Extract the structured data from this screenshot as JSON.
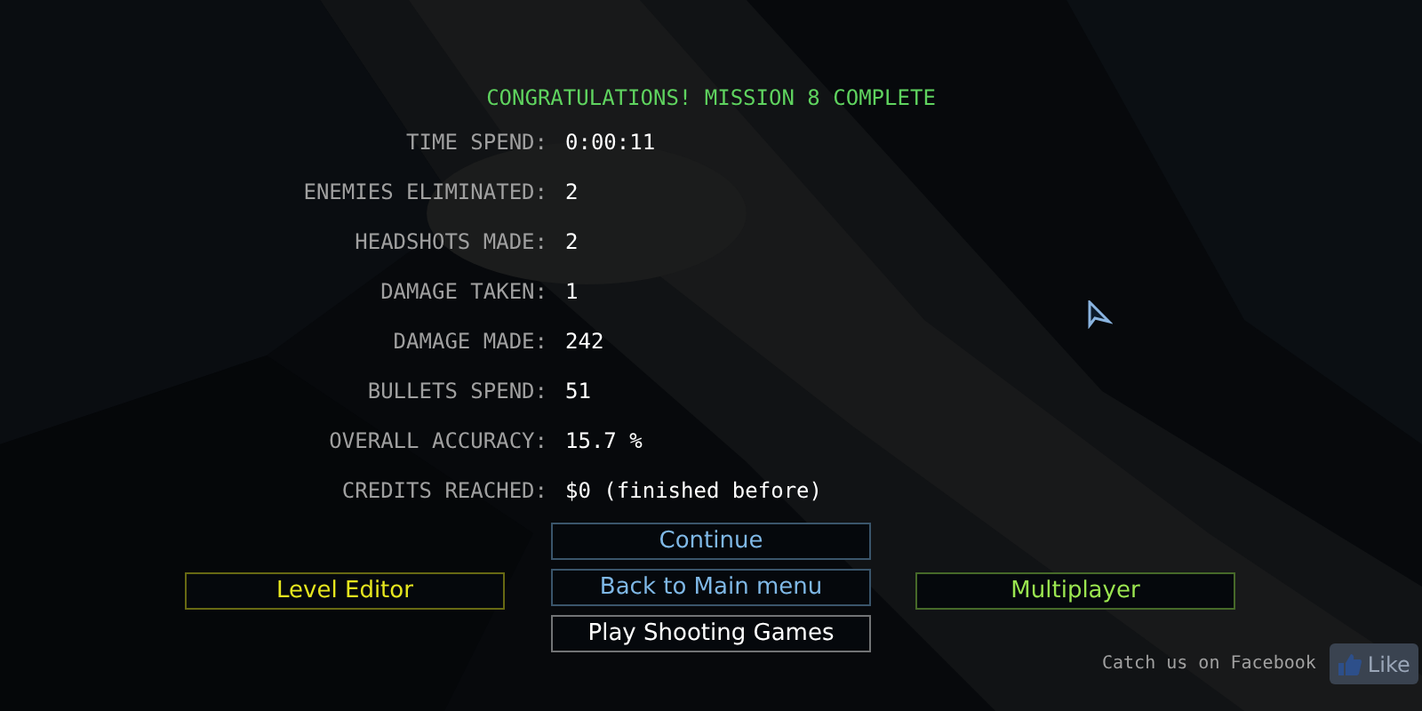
{
  "title": "CONGRATULATIONS! MISSION 8 COMPLETE",
  "stats": [
    {
      "label": "TIME SPEND:",
      "value": "0:00:11"
    },
    {
      "label": "ENEMIES ELIMINATED:",
      "value": "2"
    },
    {
      "label": "HEADSHOTS MADE:",
      "value": "2"
    },
    {
      "label": "DAMAGE TAKEN:",
      "value": "1"
    },
    {
      "label": "DAMAGE MADE:",
      "value": "242"
    },
    {
      "label": "BULLETS SPEND:",
      "value": "51"
    },
    {
      "label": "OVERALL ACCURACY:",
      "value": "15.7 %"
    },
    {
      "label": "CREDITS REACHED:",
      "value": "$0 (finished before)"
    }
  ],
  "buttons": [
    {
      "label": "Continue",
      "color": "#7fb8e6",
      "kind": "center"
    },
    {
      "label": "Level Editor",
      "color": "#e6e61e",
      "kind": "left"
    },
    {
      "label": "Back to Main menu",
      "color": "#7fb8e6",
      "kind": "center"
    },
    {
      "label": "Multiplayer",
      "color": "#9be650",
      "kind": "right"
    },
    {
      "label": "Play Shooting Games",
      "color": "#ffffff",
      "kind": "center"
    }
  ],
  "footer": {
    "text": "Catch us on Facebook",
    "like": "Like"
  }
}
